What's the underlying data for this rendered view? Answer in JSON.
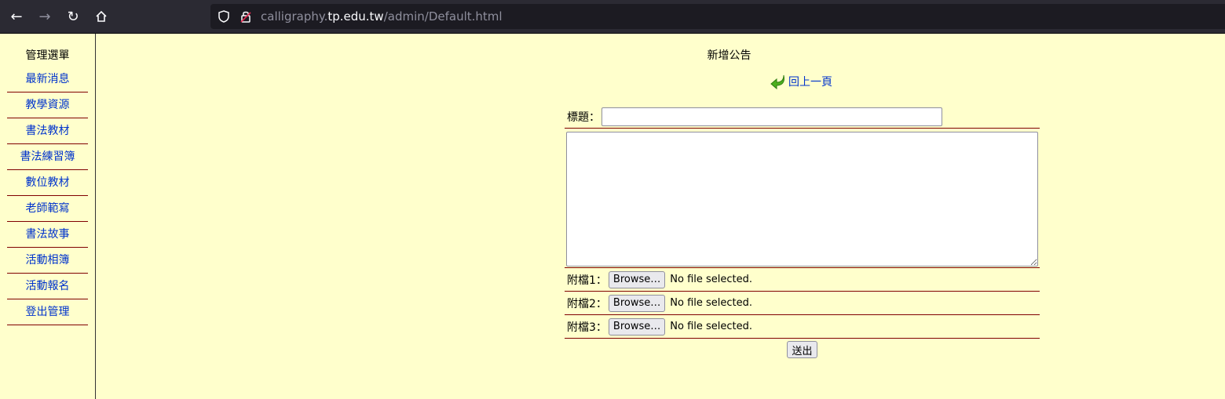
{
  "browser": {
    "url_prefix": "calligraphy.",
    "url_host": "tp.edu.tw",
    "url_path": "/admin/Default.html"
  },
  "sidebar": {
    "title": "管理選單",
    "items": [
      {
        "label": "最新消息"
      },
      {
        "label": "教學資源"
      },
      {
        "label": "書法教材"
      },
      {
        "label": "書法練習簿"
      },
      {
        "label": "數位教材"
      },
      {
        "label": "老師範寫"
      },
      {
        "label": "書法故事"
      },
      {
        "label": "活動相簿"
      },
      {
        "label": "活動報名"
      },
      {
        "label": "登出管理"
      }
    ]
  },
  "main": {
    "title": "新增公告",
    "back_label": "回上一頁",
    "form": {
      "title_label": "標題：",
      "title_value": "",
      "content_value": "",
      "attachments": [
        {
          "label": "附檔1：",
          "button": "Browse…",
          "status": "No file selected."
        },
        {
          "label": "附檔2：",
          "button": "Browse…",
          "status": "No file selected."
        },
        {
          "label": "附檔3：",
          "button": "Browse…",
          "status": "No file selected."
        }
      ],
      "submit_label": "送出"
    }
  },
  "colors": {
    "page_bg": "#ffffcc",
    "link": "#0033cc",
    "divider": "#800000"
  }
}
